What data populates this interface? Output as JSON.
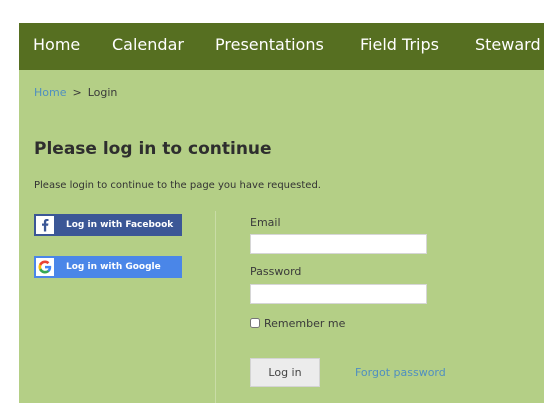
{
  "nav": {
    "items": [
      "Home",
      "Calendar",
      "Presentations",
      "Field Trips",
      "Steward"
    ]
  },
  "breadcrumb": {
    "home": "Home",
    "separator": ">",
    "current": "Login"
  },
  "page": {
    "title": "Please log in to continue",
    "subtitle": "Please login to continue to the page you have requested."
  },
  "social": {
    "facebook": {
      "label": "Log in with Facebook",
      "icon": "facebook-icon",
      "color": "#3b5796"
    },
    "google": {
      "label": "Log in with Google",
      "icon": "google-icon",
      "color": "#4a86e8"
    }
  },
  "form": {
    "email_label": "Email",
    "email_value": "",
    "password_label": "Password",
    "password_value": "",
    "remember_label": "Remember me",
    "remember_checked": false,
    "submit_label": "Log in",
    "forgot_label": "Forgot password"
  },
  "colors": {
    "nav_bg": "#566f21",
    "content_bg": "#b4cf86",
    "link": "#4f8fc0"
  }
}
